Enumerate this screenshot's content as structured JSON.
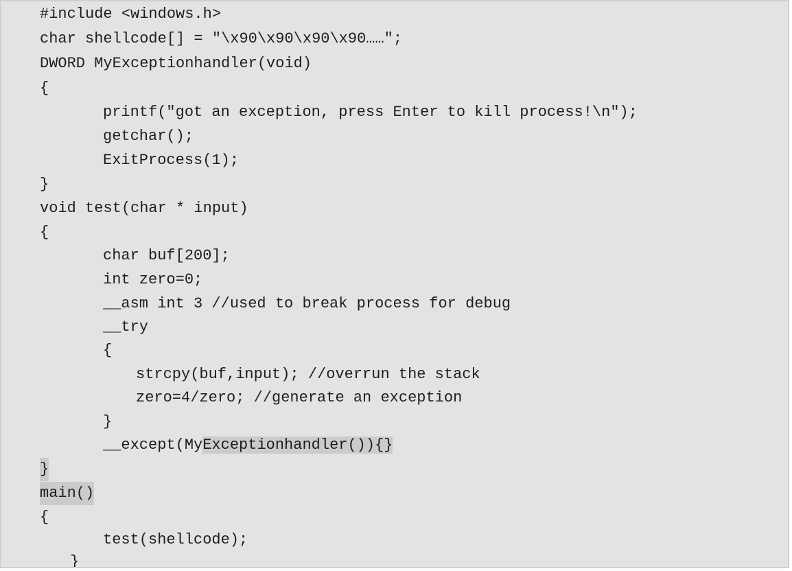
{
  "code": {
    "lines": [
      "#include <windows.h>",
      "char shellcode[] = \"\\x90\\x90\\x90\\x90……\";",
      "DWORD MyExceptionhandler(void)",
      "{",
      "printf(\"got an exception, press Enter to kill process!\\n\");",
      "getchar();",
      "ExitProcess(1);",
      "}",
      "void test(char * input)",
      "{",
      "char buf[200];",
      "int zero=0;",
      "__asm int 3 //used to break process for debug",
      "__try",
      "{",
      "strcpy(buf,input); //overrun the stack",
      "zero=4/zero; //generate an exception",
      "}",
      "__except(My",
      "Exceptionhandler()){}",
      "}",
      "main()",
      "{",
      "test(shellcode);",
      "}"
    ]
  }
}
